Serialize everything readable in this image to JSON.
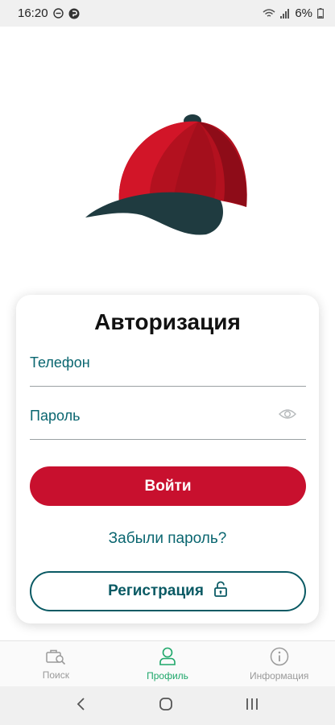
{
  "status_bar": {
    "time": "16:20",
    "battery": "6%"
  },
  "login_card": {
    "title": "Авторизация",
    "phone_label": "Телефон",
    "password_label": "Пароль",
    "login_button": "Войти",
    "forgot_password": "Забыли пароль?",
    "register_button": "Регистрация"
  },
  "bottom_nav": {
    "items": [
      {
        "label": "Поиск",
        "icon": "search-briefcase-icon",
        "active": false
      },
      {
        "label": "Профиль",
        "icon": "profile-icon",
        "active": true
      },
      {
        "label": "Информация",
        "icon": "info-icon",
        "active": false
      }
    ]
  },
  "colors": {
    "primary": "#c8102e",
    "accent": "#0a6670",
    "active_nav": "#1ea76a"
  }
}
